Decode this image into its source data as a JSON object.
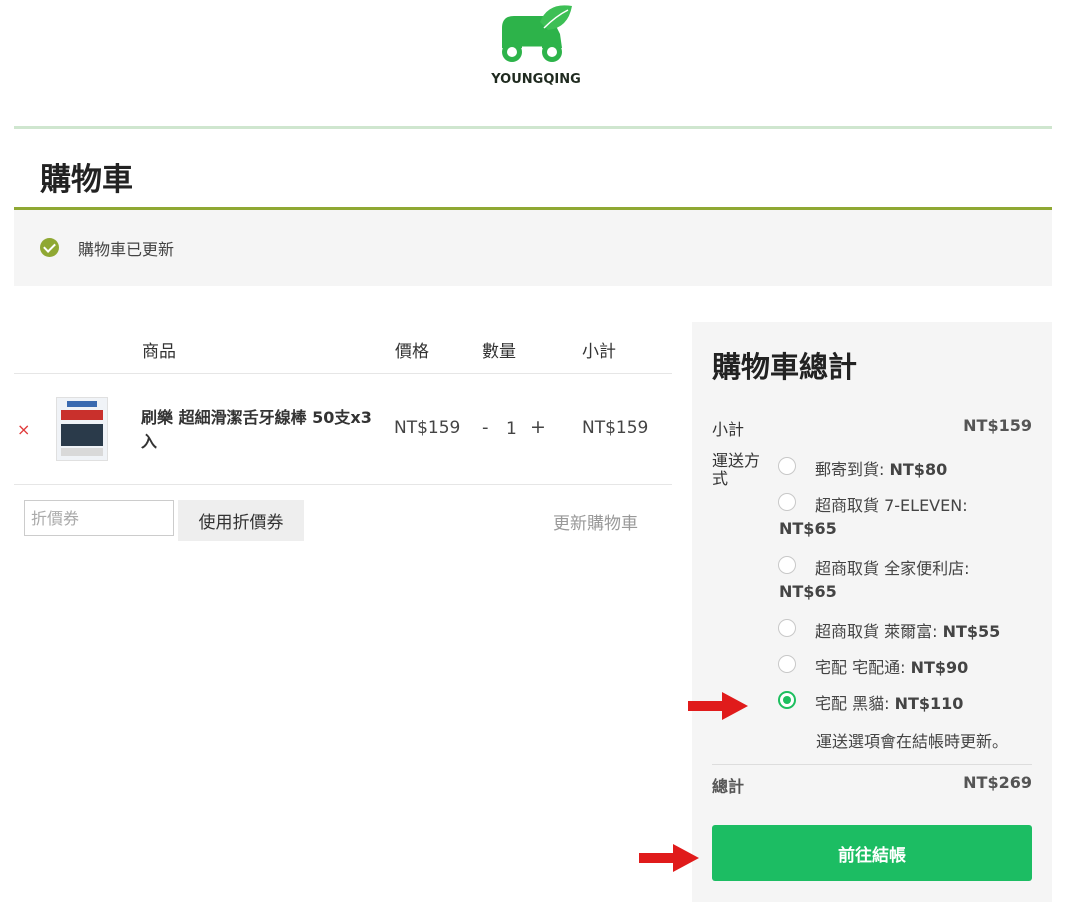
{
  "brand": {
    "name": "YOUNGQING"
  },
  "page": {
    "title": "購物車"
  },
  "notice": {
    "text": "購物車已更新"
  },
  "cart": {
    "headers": {
      "product": "商品",
      "price": "價格",
      "quantity": "數量",
      "subtotal": "小計"
    },
    "items": [
      {
        "remove": "×",
        "name": "刷樂 超細滑潔舌牙線棒 50支x3入",
        "price": "NT$159",
        "qty_minus": "-",
        "quantity": "1",
        "qty_plus": "+",
        "subtotal": "NT$159"
      }
    ],
    "coupon": {
      "placeholder": "折價券",
      "apply_label": "使用折價券"
    },
    "update_label": "更新購物車"
  },
  "totals": {
    "title": "購物車總計",
    "subtotal_label": "小計",
    "subtotal_value": "NT$159",
    "shipping_label": "運送方式",
    "shipping_options": [
      {
        "name": "郵寄到貨:",
        "amount": "NT$80",
        "selected": false
      },
      {
        "name": "超商取貨 7-ELEVEN:",
        "amount": "NT$65",
        "selected": false
      },
      {
        "name": "超商取貨 全家便利店:",
        "amount": "NT$65",
        "selected": false
      },
      {
        "name": "超商取貨 萊爾富:",
        "amount": "NT$55",
        "selected": false
      },
      {
        "name": "宅配 宅配通:",
        "amount": "NT$90",
        "selected": false
      },
      {
        "name": "宅配 黑貓:",
        "amount": "NT$110",
        "selected": true
      }
    ],
    "shipping_note": "運送選項會在結帳時更新。",
    "total_label": "總計",
    "total_value": "NT$269",
    "checkout_label": "前往結帳"
  },
  "colors": {
    "accent": "#1cbd63",
    "brand_green": "#2db34a",
    "rule_olive": "#8fa833",
    "arrow": "#e01b1b"
  }
}
